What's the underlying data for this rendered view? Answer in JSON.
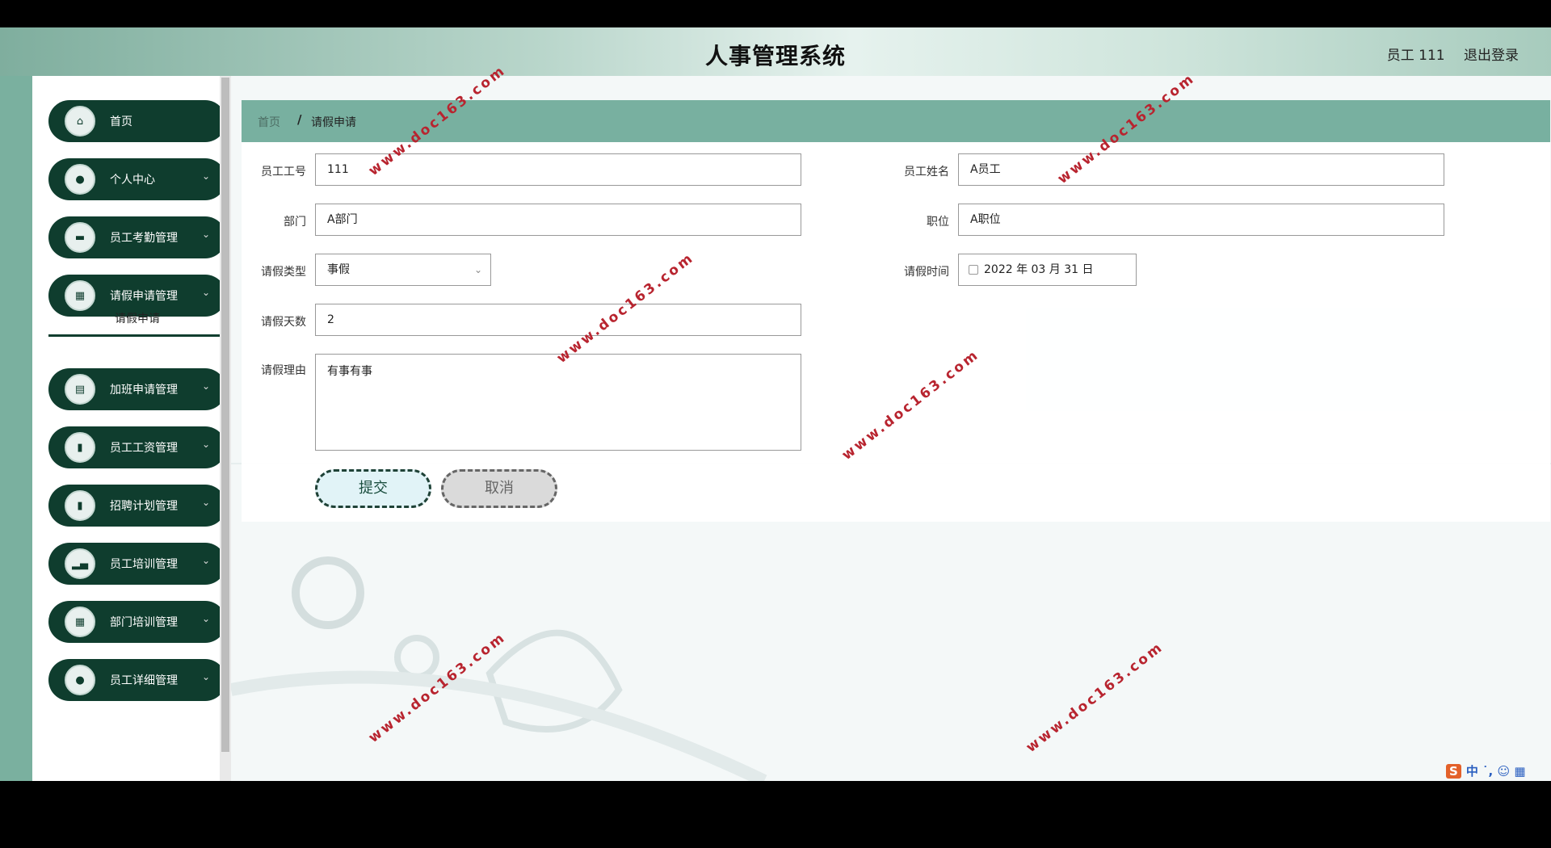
{
  "header": {
    "title": "人事管理系统",
    "user": "员工 111",
    "logout": "退出登录"
  },
  "sidebar": {
    "items": [
      {
        "label": "首页",
        "icon": "home-icon",
        "glyph": "⌂"
      },
      {
        "label": "个人中心",
        "icon": "user-icon",
        "glyph": "●"
      },
      {
        "label": "员工考勤管理",
        "icon": "monitor-icon",
        "glyph": "▬"
      },
      {
        "label": "请假申请管理",
        "icon": "grid-icon",
        "glyph": "▦"
      },
      {
        "label": "加班申请管理",
        "icon": "briefcase-icon",
        "glyph": "▤"
      },
      {
        "label": "员工工资管理",
        "icon": "clipboard-icon",
        "glyph": "▮"
      },
      {
        "label": "招聘计划管理",
        "icon": "book-icon",
        "glyph": "▮"
      },
      {
        "label": "员工培训管理",
        "icon": "bar-chart-icon",
        "glyph": "▂▄"
      },
      {
        "label": "部门培训管理",
        "icon": "grid-icon",
        "glyph": "▦"
      },
      {
        "label": "员工详细管理",
        "icon": "pin-icon",
        "glyph": "●"
      }
    ],
    "submenu_active": "请假申请"
  },
  "breadcrumb": {
    "home": "首页",
    "separator": "/",
    "current": "请假申请"
  },
  "form": {
    "employee_id_label": "员工工号",
    "employee_id": "111",
    "employee_name_label": "员工姓名",
    "employee_name": "A员工",
    "department_label": "部门",
    "department": "A部门",
    "position_label": "职位",
    "position": "A职位",
    "leave_type_label": "请假类型",
    "leave_type": "事假",
    "leave_time_label": "请假时间",
    "leave_time": "2022 年 03 月 31 日",
    "leave_days_label": "请假天数",
    "leave_days": "2",
    "reason_label": "请假理由",
    "reason": "有事有事",
    "submit": "提交",
    "cancel": "取消"
  },
  "watermark": "www.doc163.com",
  "ime": {
    "brand": "S",
    "text": "中 ˙, ☺ ▦"
  }
}
